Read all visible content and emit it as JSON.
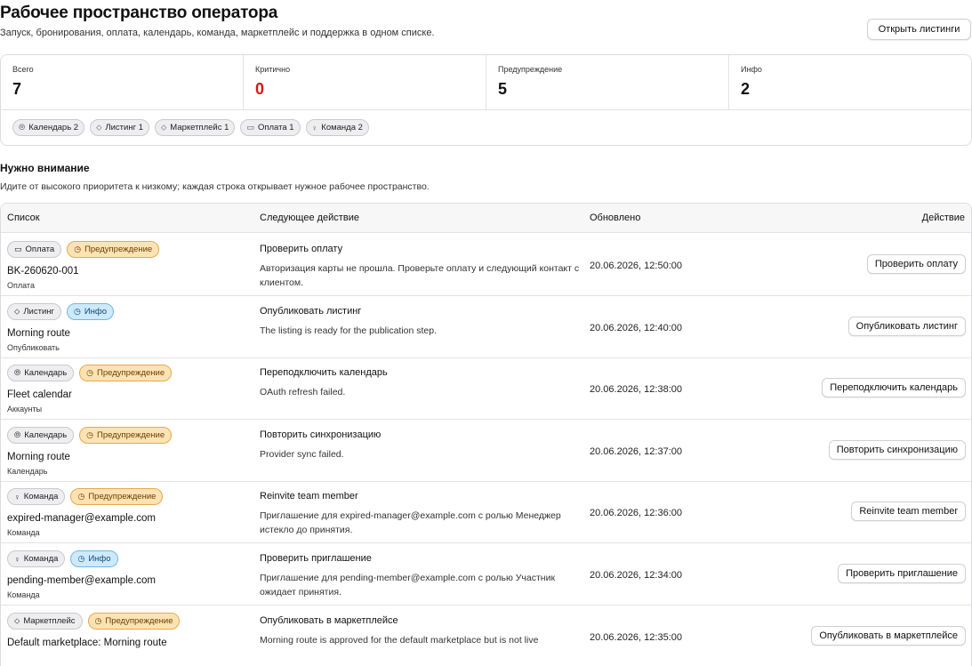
{
  "header": {
    "title": "Рабочее пространство оператора",
    "subtitle": "Запуск, бронирования, оплата, календарь, команда, маркетплейс и поддержка в одном списке.",
    "open_button": "Открыть листинги"
  },
  "stats": [
    {
      "label": "Всего",
      "value": "7"
    },
    {
      "label": "Критично",
      "value": "0"
    },
    {
      "label": "Предупреждение",
      "value": "5"
    },
    {
      "label": "Инфо",
      "value": "2"
    }
  ],
  "chips": [
    {
      "label": "Календарь 2",
      "icon": "calendar-icon"
    },
    {
      "label": "Листинг 1",
      "icon": "tag-icon"
    },
    {
      "label": "Маркетплейс 1",
      "icon": "tag-icon"
    },
    {
      "label": "Оплата 1",
      "icon": "card-icon"
    },
    {
      "label": "Команда 2",
      "icon": "person-icon"
    }
  ],
  "section": {
    "title": "Нужно внимание",
    "subtitle": "Идите от высокого приоритета к низкому; каждая строка открывает нужное рабочее пространство."
  },
  "table": {
    "headers": [
      "Список",
      "Следующее действие",
      "Обновлено",
      "Действие"
    ],
    "rows": [
      {
        "category": "Оплата",
        "category_icon": "card-icon",
        "severity": "Предупреждение",
        "severity_type": "warn",
        "title": "BK-260620-001",
        "sub": "Оплата",
        "action_title": "Проверить оплату",
        "action_desc": "Авторизация карты не прошла. Проверьте оплату и следующий контакт с клиентом.",
        "updated": "20.06.2026, 12:50:00",
        "button": "Проверить оплату"
      },
      {
        "category": "Листинг",
        "category_icon": "tag-icon",
        "severity": "Инфо",
        "severity_type": "info",
        "title": "Morning route",
        "sub": "Опубликовать",
        "action_title": "Опубликовать листинг",
        "action_desc": "The listing is ready for the publication step.",
        "updated": "20.06.2026, 12:40:00",
        "button": "Опубликовать листинг"
      },
      {
        "category": "Календарь",
        "category_icon": "calendar-icon",
        "severity": "Предупреждение",
        "severity_type": "warn",
        "title": "Fleet calendar",
        "sub": "Аккаунты",
        "action_title": "Переподключить календарь",
        "action_desc": "OAuth refresh failed.",
        "updated": "20.06.2026, 12:38:00",
        "button": "Переподключить календарь"
      },
      {
        "category": "Календарь",
        "category_icon": "calendar-icon",
        "severity": "Предупреждение",
        "severity_type": "warn",
        "title": "Morning route",
        "sub": "Календарь",
        "action_title": "Повторить синхронизацию",
        "action_desc": "Provider sync failed.",
        "updated": "20.06.2026, 12:37:00",
        "button": "Повторить синхронизацию"
      },
      {
        "category": "Команда",
        "category_icon": "person-icon",
        "severity": "Предупреждение",
        "severity_type": "warn",
        "title": "expired-manager@example.com",
        "sub": "Команда",
        "action_title": "Reinvite team member",
        "action_desc": "Приглашение для expired-manager@example.com с ролью Менеджер истекло до принятия.",
        "updated": "20.06.2026, 12:36:00",
        "button": "Reinvite team member"
      },
      {
        "category": "Команда",
        "category_icon": "person-icon",
        "severity": "Инфо",
        "severity_type": "info",
        "title": "pending-member@example.com",
        "sub": "Команда",
        "action_title": "Проверить приглашение",
        "action_desc": "Приглашение для pending-member@example.com с ролью Участник ожидает принятия.",
        "updated": "20.06.2026, 12:34:00",
        "button": "Проверить приглашение"
      },
      {
        "category": "Маркетплейс",
        "category_icon": "tag-icon",
        "severity": "Предупреждение",
        "severity_type": "warn",
        "title": "Default marketplace: Morning route",
        "sub": "",
        "action_title": "Опубликовать в маркетплейсе",
        "action_desc": "Morning route is approved for the default marketplace but is not live",
        "updated": "20.06.2026, 12:35:00",
        "button": "Опубликовать в маркетплейсе"
      }
    ]
  }
}
